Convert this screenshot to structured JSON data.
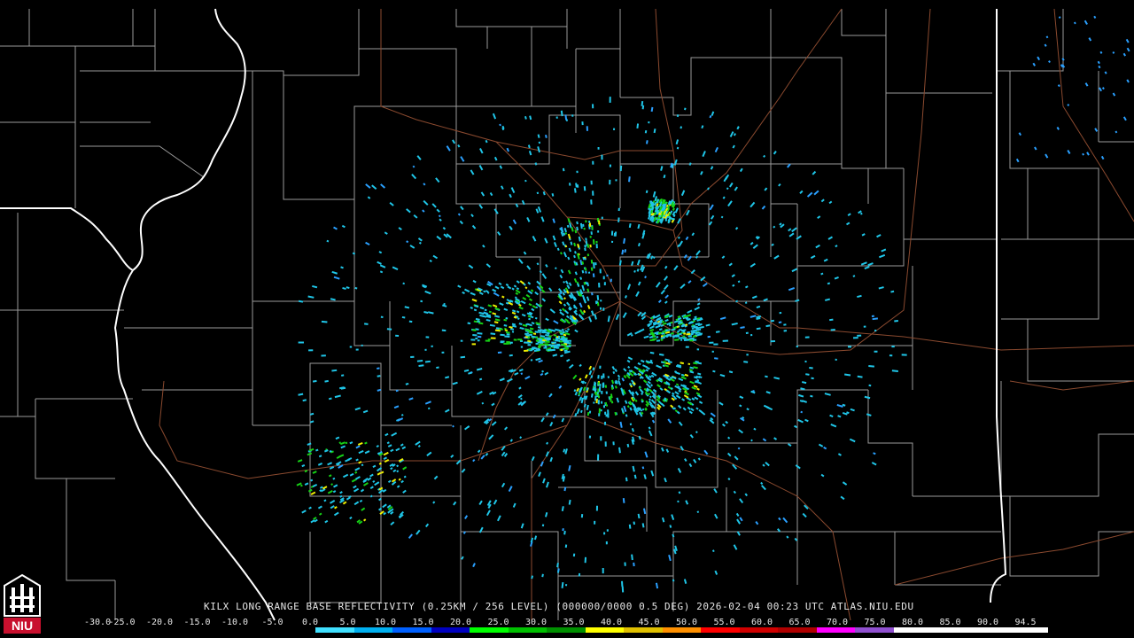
{
  "product": {
    "caption": "KILX LONG RANGE BASE REFLECTIVITY (0.25KM / 256 LEVEL) (000000/0000 0.5 DEG) 2026-02-04 00:23 UTC  ATLAS.NIU.EDU",
    "station": "KILX",
    "source": "ATLAS.NIU.EDU"
  },
  "logo": {
    "text": "NIU",
    "color": "#c8102e"
  },
  "colors": {
    "background": "#000000",
    "state_border": "#ffffff",
    "county_border": "#9a9a9a",
    "highway": "#8b4a2f"
  },
  "scale": {
    "labels": [
      "-30.0",
      "-25.0",
      "-20.0",
      "-15.0",
      "-10.0",
      "-5.0",
      "0.0",
      "5.0",
      "10.0",
      "15.0",
      "20.0",
      "25.0",
      "30.0",
      "35.0",
      "40.0",
      "45.0",
      "50.0",
      "55.0",
      "60.0",
      "65.0",
      "70.0",
      "75.0",
      "80.0",
      "85.0",
      "90.0",
      "94.5"
    ],
    "colors": [
      "#000000",
      "#000000",
      "#000000",
      "#000000",
      "#000000",
      "#000000",
      "#40e0ff",
      "#00b0f0",
      "#0060ff",
      "#0000c0",
      "#00ff00",
      "#00c000",
      "#009000",
      "#ffff00",
      "#e0c000",
      "#ff9000",
      "#ff0000",
      "#d00000",
      "#b00000",
      "#ff00ff",
      "#9050d0",
      "#ffffff",
      "#ffffff",
      "#ffffff",
      "#ffffff"
    ]
  },
  "echo_levels": {
    "light": "#1fc6e8",
    "light2": "#2aa0ff",
    "medium": "#16d216",
    "heavy": "#f0f000"
  }
}
